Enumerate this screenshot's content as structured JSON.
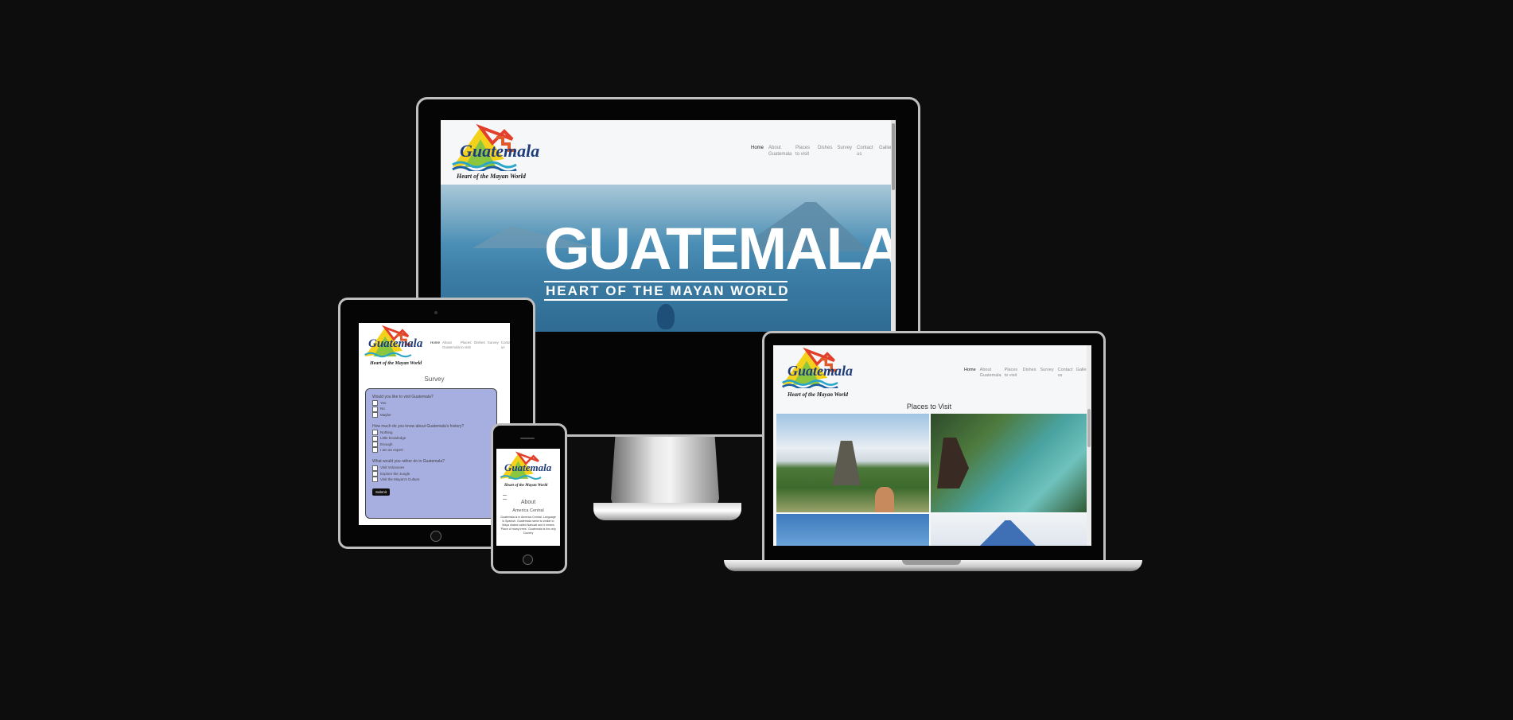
{
  "site": {
    "logo_word": "Guatemala",
    "logo_tagline": "Heart of the Mayan World",
    "nav": [
      "Home",
      "About Guatemala",
      "Places to visit",
      "Dishes",
      "Survey",
      "Contact us",
      "Gallery"
    ]
  },
  "desktop": {
    "hero_title": "GUATEMALA",
    "hero_subtitle": "HEART OF THE MAYAN WORLD"
  },
  "tablet": {
    "section_title": "Survey",
    "q1": "Would you like to visit Guatemala?",
    "q1_options": [
      "Yes",
      "No",
      "Maybe"
    ],
    "q2": "How much do you know about Guatemala's history?",
    "q2_options": [
      "Nothing",
      "Little knowledge",
      "Enough",
      "I am an expert"
    ],
    "q3": "What would you rather do in Guatemala?",
    "q3_options": [
      "Visit Volcanoes",
      "Explore the Jungle",
      "Visit the Mayan's Culture"
    ],
    "submit_label": "Submit"
  },
  "phone": {
    "section_title": "About",
    "subtitle": "America Central",
    "body": "Guatemala is in America Central. Language is Spanish. Guatemala name is similar to Maya dialect called Nahuatl and it means 'Place of many trees.' Guatemala is the only Country"
  },
  "laptop": {
    "section_title": "Places to Visit"
  },
  "colors": {
    "background": "#0d0d0d",
    "survey_panel": "#a7aee0",
    "site_bg": "#f6f7f8",
    "lake_blue": "#3f86ad"
  }
}
